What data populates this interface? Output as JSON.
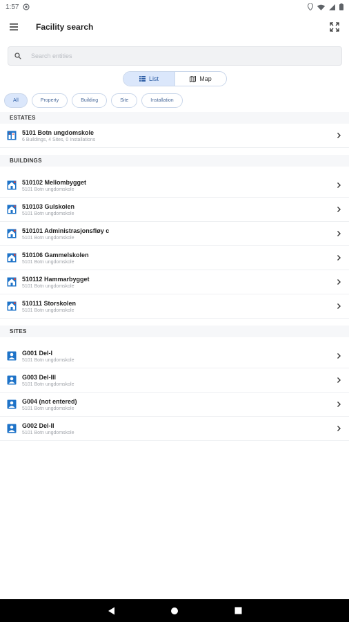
{
  "status": {
    "time": "1:57"
  },
  "app": {
    "title": "Facility search"
  },
  "search": {
    "placeholder": "Search entities",
    "value": ""
  },
  "view_toggle": {
    "list_label": "List",
    "map_label": "Map",
    "active": "list"
  },
  "filters": [
    {
      "label": "All",
      "active": true
    },
    {
      "label": "Property",
      "active": false
    },
    {
      "label": "Building",
      "active": false
    },
    {
      "label": "Site",
      "active": false
    },
    {
      "label": "Installation",
      "active": false
    }
  ],
  "sections": {
    "estates": {
      "header": "ESTATES",
      "items": [
        {
          "title": "5101 Botn ungdomskole",
          "subtitle": "6 Buildings, 4 Sites, 0 Installations"
        }
      ]
    },
    "buildings": {
      "header": "BUILDINGS",
      "items": [
        {
          "title": "510102 Mellombygget",
          "subtitle": "5101 Botn ungdomskole"
        },
        {
          "title": "510103 Gulskolen",
          "subtitle": "5101 Botn ungdomskole"
        },
        {
          "title": "510101 Administrasjonsfløy c",
          "subtitle": "5101 Botn ungdomskole"
        },
        {
          "title": "510106 Gammelskolen",
          "subtitle": "5101 Botn ungdomskole"
        },
        {
          "title": "510112 Hammarbygget",
          "subtitle": "5101 Botn ungdomskole"
        },
        {
          "title": "510111 Storskolen",
          "subtitle": "5101 Botn ungdomskole"
        }
      ]
    },
    "sites": {
      "header": "SITES",
      "items": [
        {
          "title": "G001 Del-I",
          "subtitle": "5101 Botn ungdomskole"
        },
        {
          "title": "G003 Del-III",
          "subtitle": "5101 Botn ungdomskole"
        },
        {
          "title": "G004 (not entered)",
          "subtitle": "5101 Botn ungdomskole"
        },
        {
          "title": "G002 Del-II",
          "subtitle": "5101 Botn ungdomskole"
        }
      ]
    }
  },
  "icons": {
    "menu": "menu-icon",
    "expand": "fullscreen-icon",
    "search": "search-icon",
    "list": "list-icon",
    "map": "map-icon",
    "estate": "estate-icon",
    "building": "building-icon",
    "site": "site-icon",
    "chevron": "chevron-right-icon"
  },
  "colors": {
    "accent": "#2f5fa6",
    "chip_active_bg": "#dbe7fb",
    "icon_blue": "#1e73c8",
    "icon_red": "#e0453a"
  }
}
